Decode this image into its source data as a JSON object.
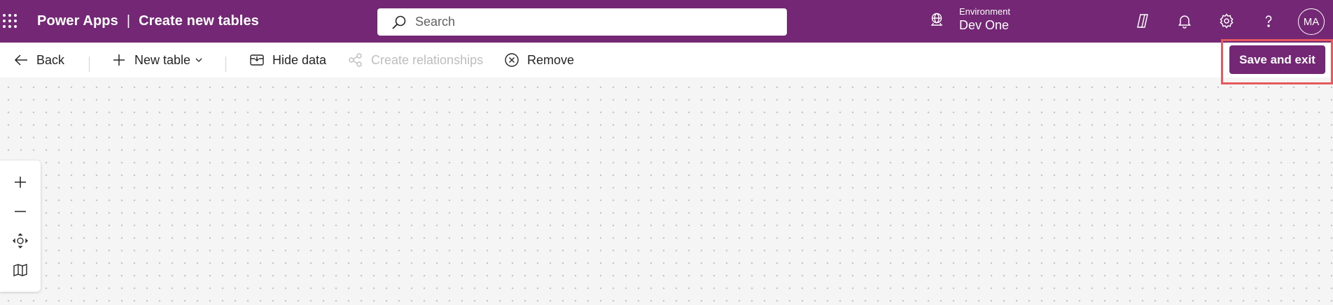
{
  "header": {
    "app_name": "Power Apps",
    "separator": "|",
    "page_title": "Create new tables",
    "search_placeholder": "Search",
    "environment_label": "Environment",
    "environment_value": "Dev One",
    "avatar_initials": "MA",
    "background_color": "#742774",
    "icons": [
      "waffle-icon",
      "search-icon",
      "environment-icon",
      "copilot-icon",
      "bell-icon",
      "gear-icon",
      "help-icon"
    ]
  },
  "toolbar": {
    "back_label": "Back",
    "new_table_label": "New table",
    "hide_data_label": "Hide data",
    "create_relationships_label": "Create relationships",
    "remove_label": "Remove",
    "save_label": "Save and exit"
  },
  "canvas": {
    "zoom_controls": [
      "zoom-in-icon",
      "zoom-out-icon",
      "fit-view-icon",
      "minimap-icon"
    ]
  },
  "colors": {
    "brand": "#742774",
    "highlight_box": "#e5595f",
    "disabled_text": "#bdbdbd"
  }
}
